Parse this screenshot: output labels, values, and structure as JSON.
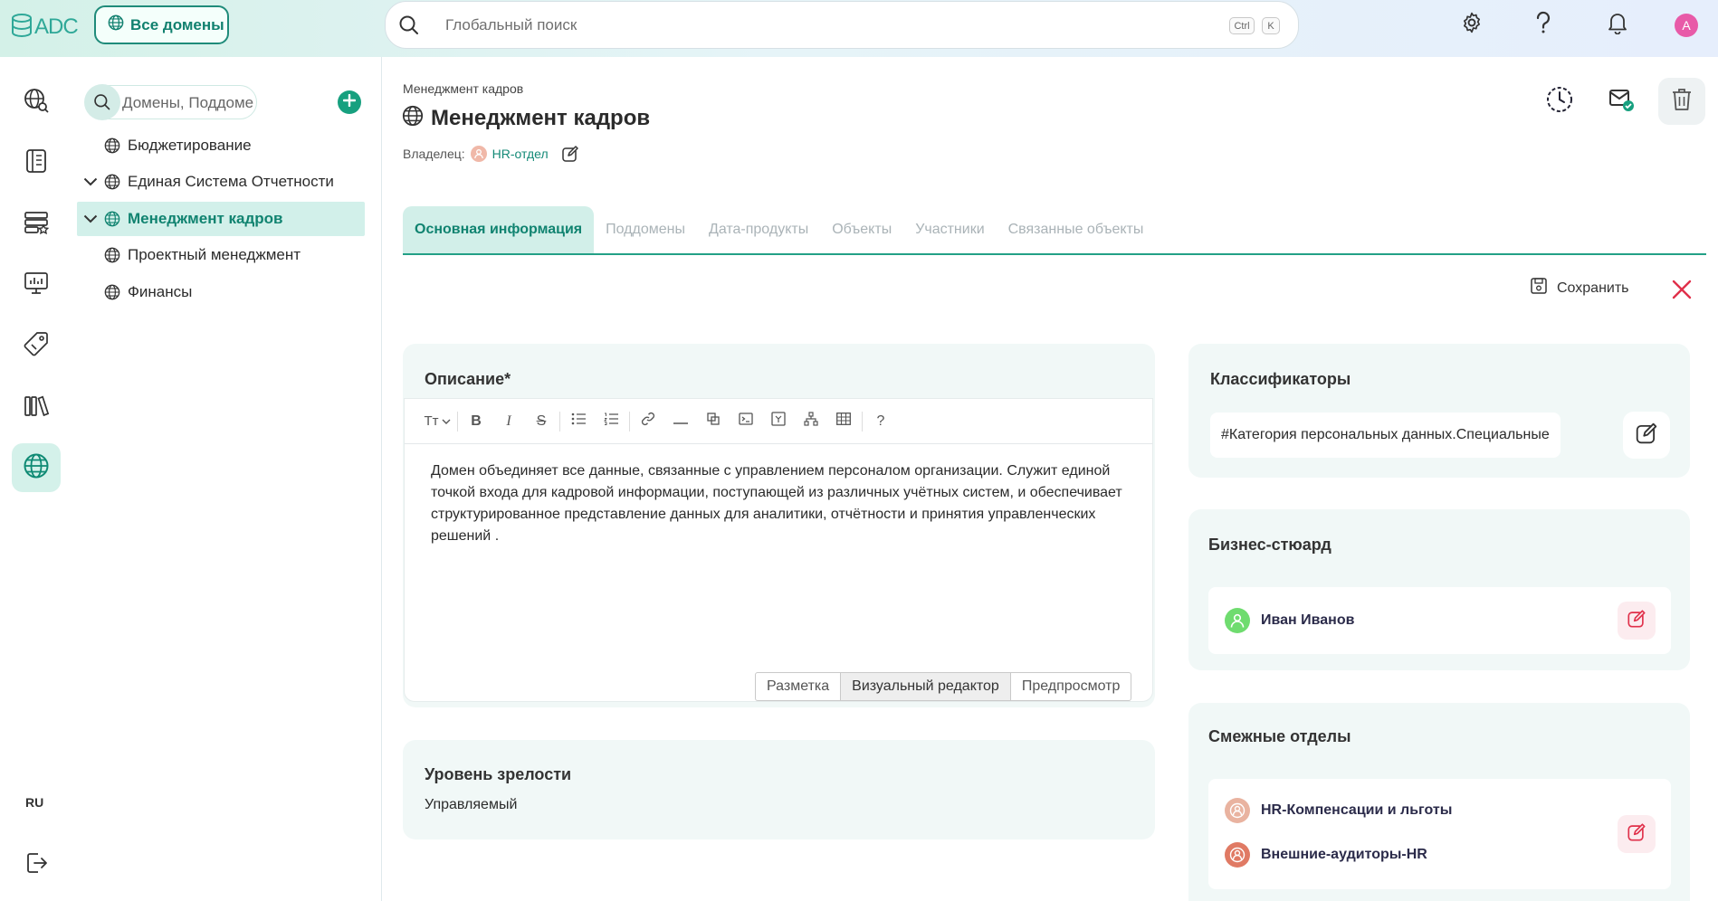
{
  "header": {
    "logo_text": "ADC",
    "all_domains_label": "Все домены",
    "search_placeholder": "Глобальный поиск",
    "shortcut_key1": "Ctrl",
    "shortcut_key2": "K",
    "avatar_letter": "A"
  },
  "rail": {
    "lang": "RU"
  },
  "tree": {
    "search_placeholder": "Домены, Поддоме...",
    "items": [
      {
        "label": "Бюджетирование",
        "expanded": false,
        "has_children": false
      },
      {
        "label": "Единая Система Отчетности",
        "expanded": true,
        "has_children": true
      },
      {
        "label": "Менеджмент кадров",
        "expanded": true,
        "has_children": true,
        "active": true
      },
      {
        "label": "Проектный менеджмент",
        "has_children": false
      },
      {
        "label": "Финансы",
        "has_children": false
      }
    ]
  },
  "main": {
    "breadcrumb": "Менеджмент кадров",
    "title": "Менеджмент кадров",
    "owner_label": "Владелец:",
    "owner_value": "HR-отдел",
    "tabs": [
      "Основная информация",
      "Поддомены",
      "Дата-продукты",
      "Объекты",
      "Участники",
      "Связанные объекты"
    ],
    "save_label": "Сохранить"
  },
  "description": {
    "title": "Описание*",
    "text": "Домен объединяет все данные, связанные с управлением персоналом организации. Служит единой точкой входа для кадровой информации, поступающей из различных учётных систем, и обеспечивает структурированное представление данных для аналитики, отчётности и принятия управленческих решений .",
    "modes": [
      "Разметка",
      "Визуальный редактор",
      "Предпросмотр"
    ],
    "active_mode": "Визуальный редактор",
    "toolbar_text_icon": "Tт",
    "help": "?"
  },
  "maturity": {
    "title": "Уровень зрелости",
    "value": "Управляемый"
  },
  "classifiers": {
    "title": "Классификаторы",
    "chip": "#Категория персональных данных.Специальные"
  },
  "steward": {
    "title": "Бизнес-стюард",
    "name": "Иван Иванов"
  },
  "related": {
    "title": "Смежные отделы",
    "items": [
      "HR-Компенсации и льготы",
      "Внешние-аудиторы-HR"
    ]
  },
  "colors": {
    "accent": "#17a07f",
    "accent_dark": "#108370",
    "card_bg": "#f1f8f7",
    "danger": "#e0304a"
  }
}
